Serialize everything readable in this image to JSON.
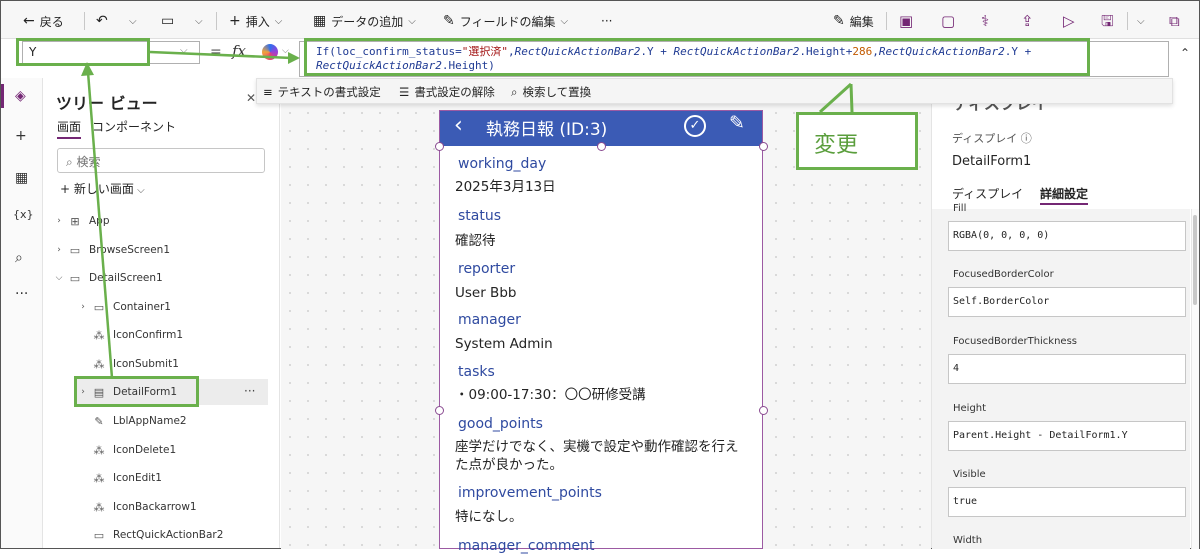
{
  "toolbar": {
    "back_label": "戻る",
    "insert_label": "挿入",
    "add_data_label": "データの追加",
    "edit_fields_label": "フィールドの編集",
    "more_label": "···",
    "edit_label": "編集"
  },
  "formula_bar": {
    "property": "Y",
    "equals": "=",
    "fx": "fx",
    "formula_line1_parts": [
      "If(loc_confirm_status=",
      "\"選択済\"",
      ",",
      "RectQuickActionBar2",
      ".Y + ",
      "RectQuickActionBar2",
      ".Height+",
      "286",
      ",",
      "RectQuickActionBar2",
      ".Y +"
    ],
    "formula_line2_parts": [
      "RectQuickActionBar2",
      ".Height)"
    ]
  },
  "format_bar": {
    "format_text": "テキストの書式設定",
    "remove_format": "書式設定の解除",
    "find_replace": "検索して置換"
  },
  "tree": {
    "title": "ツリー ビュー",
    "tab_screens": "画面",
    "tab_components": "コンポーネント",
    "search_placeholder": "検索",
    "new_screen": "新しい画面",
    "items": [
      {
        "label": "App"
      },
      {
        "label": "BrowseScreen1"
      },
      {
        "label": "DetailScreen1"
      },
      {
        "label": "Container1"
      },
      {
        "label": "IconConfirm1"
      },
      {
        "label": "IconSubmit1"
      },
      {
        "label": "DetailForm1"
      },
      {
        "label": "LblAppName2"
      },
      {
        "label": "IconDelete1"
      },
      {
        "label": "IconEdit1"
      },
      {
        "label": "IconBackarrow1"
      },
      {
        "label": "RectQuickActionBar2"
      }
    ]
  },
  "app": {
    "title": "執務日報 (ID:3)",
    "fields": [
      {
        "label": "working_day",
        "value": "2025年3月13日"
      },
      {
        "label": "status",
        "value": "確認待"
      },
      {
        "label": "reporter",
        "value": "User Bbb"
      },
      {
        "label": "manager",
        "value": "System Admin"
      },
      {
        "label": "tasks",
        "value": "・09:00-17:30：〇〇研修受講"
      },
      {
        "label": "good_points",
        "value": "座学だけでなく、実機で設定や動作確認を行えた点が良かった。"
      },
      {
        "label": "improvement_points",
        "value": "特になし。"
      },
      {
        "label": "manager_comment",
        "value": ""
      }
    ]
  },
  "annotation": {
    "callout": "変更",
    "color": "#6ab04c"
  },
  "right_panel": {
    "title": "ディスプレイ",
    "display_label": "ディスプレイ",
    "control_name": "DetailForm1",
    "tab_display": "ディスプレイ",
    "tab_advanced": "詳細設定",
    "properties": [
      {
        "name": "Fill",
        "value": "RGBA(0, 0, 0, 0)"
      },
      {
        "name": "FocusedBorderColor",
        "value": "Self.BorderColor"
      },
      {
        "name": "FocusedBorderThickness",
        "value": "4"
      },
      {
        "name": "Height",
        "value": "Parent.Height - DetailForm1.Y"
      },
      {
        "name": "Visible",
        "value": "true"
      },
      {
        "name": "Width",
        "value": ""
      }
    ]
  },
  "colors": {
    "accent": "#742774",
    "app_header": "#3b5bb5",
    "field_label": "#2f4aa0"
  }
}
